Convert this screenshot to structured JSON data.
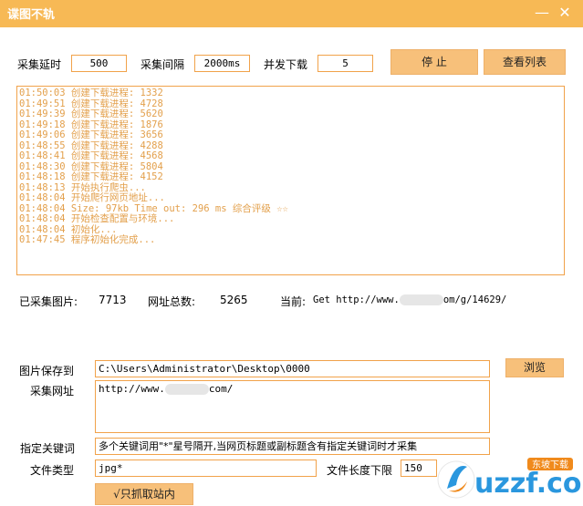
{
  "window": {
    "title": "谍图不轨",
    "minimize": "—",
    "close": "✕"
  },
  "settings": {
    "delay_label": "采集延时",
    "delay_value": "500",
    "interval_label": "采集间隔",
    "interval_value": "2000ms",
    "concurrency_label": "并发下载",
    "concurrency_value": "5",
    "stop_label": "停 止",
    "view_list_label": "查看列表"
  },
  "log": [
    "01:50:03  创建下载进程: 1332",
    "01:49:51  创建下载进程: 4728",
    "01:49:39  创建下载进程: 5620",
    "01:49:18  创建下载进程: 1876",
    "01:49:06  创建下载进程: 3656",
    "01:48:55  创建下载进程: 4288",
    "01:48:41  创建下载进程: 4568",
    "01:48:30  创建下载进程: 5804",
    "01:48:18  创建下载进程: 4152",
    "01:48:13  开始执行爬虫...",
    "01:48:04  开始爬行网页地址...",
    "01:48:04  Size: 97kb  Time out: 296 ms  综合评级 ☆☆",
    "01:48:04  开始检查配置与环境...",
    "01:48:04  初始化...",
    "01:47:45  程序初始化完成..."
  ],
  "stats": {
    "collected_label": "已采集图片:",
    "collected_value": "7713",
    "url_total_label": "网址总数:",
    "url_total_value": "5265",
    "current_label": "当前:",
    "current_prefix": "Get http://www.",
    "current_suffix": "om/g/14629/"
  },
  "form": {
    "save_label": "图片保存到",
    "save_value": "C:\\Users\\Administrator\\Desktop\\0000",
    "browse_label": "浏览",
    "url_label": "采集网址",
    "url_prefix": "http://www.",
    "url_suffix": "com/",
    "keyword_label": "指定关键词",
    "keyword_value": "多个关键词用\"*\"星号隔开,当网页标题或副标题含有指定关键词时才采集",
    "filetype_label": "文件类型",
    "filetype_value": "jpg*",
    "filelen_label": "文件长度下限",
    "filelen_value": "150",
    "site_only_label": "√只抓取站内"
  },
  "watermark": {
    "text": "uzzf.com",
    "badge": "东坡下载"
  },
  "colors": {
    "accent": "#f7b955",
    "button": "#f7c07a",
    "border": "#f1a24a",
    "log_text": "#e3a04c"
  }
}
